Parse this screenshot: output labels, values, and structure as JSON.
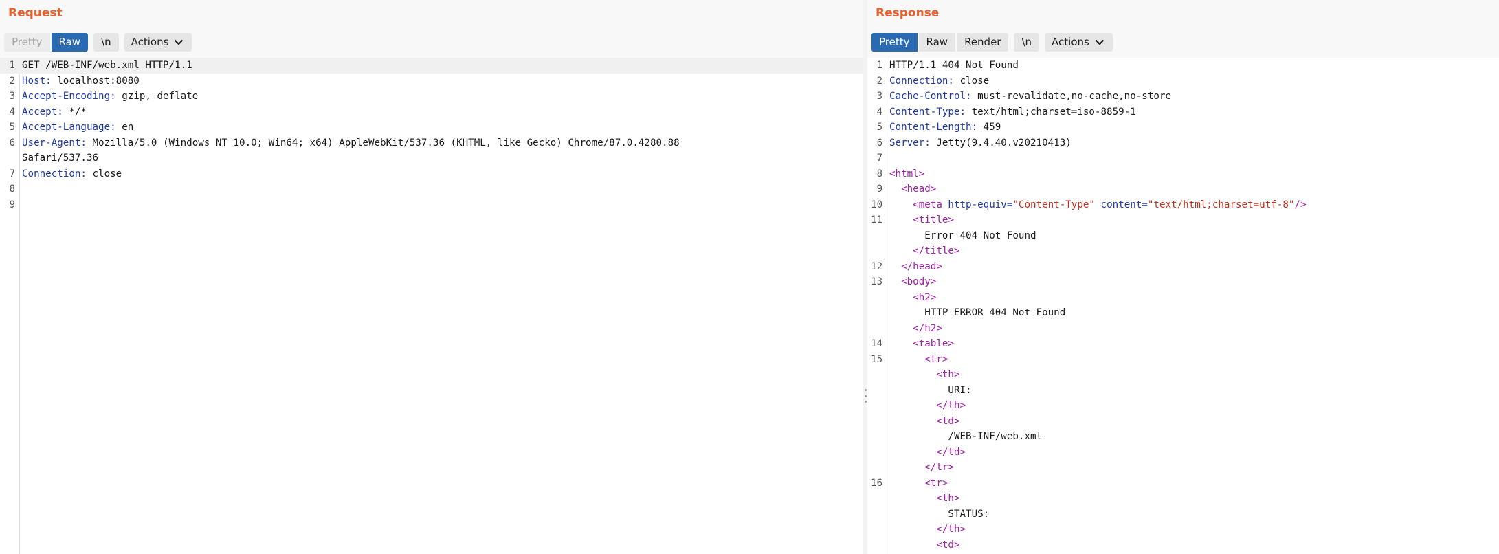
{
  "request": {
    "title": "Request",
    "buttons": {
      "pretty": "Pretty",
      "raw": "Raw",
      "newline": "\\n",
      "actions": "Actions"
    },
    "lines": [
      {
        "n": "1",
        "segs": [
          {
            "t": "txt",
            "v": "GET /WEB-INF/web.xml HTTP/1.1"
          }
        ]
      },
      {
        "n": "2",
        "segs": [
          {
            "t": "hdr-name",
            "v": "Host:"
          },
          {
            "t": "hdr-val",
            "v": " localhost:8080"
          }
        ]
      },
      {
        "n": "3",
        "segs": [
          {
            "t": "hdr-name",
            "v": "Accept-Encoding:"
          },
          {
            "t": "hdr-val",
            "v": " gzip, deflate"
          }
        ]
      },
      {
        "n": "4",
        "segs": [
          {
            "t": "hdr-name",
            "v": "Accept:"
          },
          {
            "t": "hdr-val",
            "v": " */*"
          }
        ]
      },
      {
        "n": "5",
        "segs": [
          {
            "t": "hdr-name",
            "v": "Accept-Language:"
          },
          {
            "t": "hdr-val",
            "v": " en"
          }
        ]
      },
      {
        "n": "6",
        "segs": [
          {
            "t": "hdr-name",
            "v": "User-Agent:"
          },
          {
            "t": "hdr-val",
            "v": " Mozilla/5.0 (Windows NT 10.0; Win64; x64) AppleWebKit/537.36 (KHTML, like Gecko) Chrome/87.0.4280.88"
          }
        ]
      },
      {
        "n": "",
        "segs": [
          {
            "t": "hdr-val",
            "v": "Safari/537.36"
          }
        ]
      },
      {
        "n": "7",
        "segs": [
          {
            "t": "hdr-name",
            "v": "Connection:"
          },
          {
            "t": "hdr-val",
            "v": " close"
          }
        ]
      },
      {
        "n": "8",
        "segs": []
      },
      {
        "n": "9",
        "segs": []
      }
    ]
  },
  "response": {
    "title": "Response",
    "buttons": {
      "pretty": "Pretty",
      "raw": "Raw",
      "render": "Render",
      "newline": "\\n",
      "actions": "Actions"
    },
    "lines": [
      {
        "n": "1",
        "segs": [
          {
            "t": "txt",
            "v": "HTTP/1.1 404 Not Found"
          }
        ]
      },
      {
        "n": "2",
        "segs": [
          {
            "t": "hdr-name",
            "v": "Connection:"
          },
          {
            "t": "hdr-val",
            "v": " close"
          }
        ]
      },
      {
        "n": "3",
        "segs": [
          {
            "t": "hdr-name",
            "v": "Cache-Control:"
          },
          {
            "t": "hdr-val",
            "v": " must-revalidate,no-cache,no-store"
          }
        ]
      },
      {
        "n": "4",
        "segs": [
          {
            "t": "hdr-name",
            "v": "Content-Type:"
          },
          {
            "t": "hdr-val",
            "v": " text/html;charset=iso-8859-1"
          }
        ]
      },
      {
        "n": "5",
        "segs": [
          {
            "t": "hdr-name",
            "v": "Content-Length:"
          },
          {
            "t": "hdr-val",
            "v": " 459"
          }
        ]
      },
      {
        "n": "6",
        "segs": [
          {
            "t": "hdr-name",
            "v": "Server:"
          },
          {
            "t": "hdr-val",
            "v": " Jetty(9.4.40.v20210413)"
          }
        ]
      },
      {
        "n": "7",
        "segs": []
      },
      {
        "n": "8",
        "segs": [
          {
            "t": "tag",
            "v": "<html>"
          }
        ]
      },
      {
        "n": "9",
        "segs": [
          {
            "t": "txt",
            "v": "  "
          },
          {
            "t": "tag",
            "v": "<head>"
          }
        ]
      },
      {
        "n": "10",
        "segs": [
          {
            "t": "txt",
            "v": "    "
          },
          {
            "t": "tag",
            "v": "<meta "
          },
          {
            "t": "attr",
            "v": "http-equiv="
          },
          {
            "t": "str",
            "v": "\"Content-Type\""
          },
          {
            "t": "txt",
            "v": " "
          },
          {
            "t": "attr",
            "v": "content="
          },
          {
            "t": "str",
            "v": "\"text/html;charset=utf-8\""
          },
          {
            "t": "tag",
            "v": "/>"
          }
        ]
      },
      {
        "n": "11",
        "segs": [
          {
            "t": "txt",
            "v": "    "
          },
          {
            "t": "tag",
            "v": "<title>"
          }
        ]
      },
      {
        "n": "",
        "segs": [
          {
            "t": "txt",
            "v": "      Error 404 Not Found"
          }
        ]
      },
      {
        "n": "",
        "segs": [
          {
            "t": "txt",
            "v": "    "
          },
          {
            "t": "tag",
            "v": "</title>"
          }
        ]
      },
      {
        "n": "12",
        "segs": [
          {
            "t": "txt",
            "v": "  "
          },
          {
            "t": "tag",
            "v": "</head>"
          }
        ]
      },
      {
        "n": "13",
        "segs": [
          {
            "t": "txt",
            "v": "  "
          },
          {
            "t": "tag",
            "v": "<body>"
          }
        ]
      },
      {
        "n": "",
        "segs": [
          {
            "t": "txt",
            "v": "    "
          },
          {
            "t": "tag",
            "v": "<h2>"
          }
        ]
      },
      {
        "n": "",
        "segs": [
          {
            "t": "txt",
            "v": "      HTTP ERROR 404 Not Found"
          }
        ]
      },
      {
        "n": "",
        "segs": [
          {
            "t": "txt",
            "v": "    "
          },
          {
            "t": "tag",
            "v": "</h2>"
          }
        ]
      },
      {
        "n": "14",
        "segs": [
          {
            "t": "txt",
            "v": "    "
          },
          {
            "t": "tag",
            "v": "<table>"
          }
        ]
      },
      {
        "n": "15",
        "segs": [
          {
            "t": "txt",
            "v": "      "
          },
          {
            "t": "tag",
            "v": "<tr>"
          }
        ]
      },
      {
        "n": "",
        "segs": [
          {
            "t": "txt",
            "v": "        "
          },
          {
            "t": "tag",
            "v": "<th>"
          }
        ]
      },
      {
        "n": "",
        "segs": [
          {
            "t": "txt",
            "v": "          URI:"
          }
        ]
      },
      {
        "n": "",
        "segs": [
          {
            "t": "txt",
            "v": "        "
          },
          {
            "t": "tag",
            "v": "</th>"
          }
        ]
      },
      {
        "n": "",
        "segs": [
          {
            "t": "txt",
            "v": "        "
          },
          {
            "t": "tag",
            "v": "<td>"
          }
        ]
      },
      {
        "n": "",
        "segs": [
          {
            "t": "txt",
            "v": "          /WEB-INF/web.xml"
          }
        ]
      },
      {
        "n": "",
        "segs": [
          {
            "t": "txt",
            "v": "        "
          },
          {
            "t": "tag",
            "v": "</td>"
          }
        ]
      },
      {
        "n": "",
        "segs": [
          {
            "t": "txt",
            "v": "      "
          },
          {
            "t": "tag",
            "v": "</tr>"
          }
        ]
      },
      {
        "n": "16",
        "segs": [
          {
            "t": "txt",
            "v": "      "
          },
          {
            "t": "tag",
            "v": "<tr>"
          }
        ]
      },
      {
        "n": "",
        "segs": [
          {
            "t": "txt",
            "v": "        "
          },
          {
            "t": "tag",
            "v": "<th>"
          }
        ]
      },
      {
        "n": "",
        "segs": [
          {
            "t": "txt",
            "v": "          STATUS:"
          }
        ]
      },
      {
        "n": "",
        "segs": [
          {
            "t": "txt",
            "v": "        "
          },
          {
            "t": "tag",
            "v": "</th>"
          }
        ]
      },
      {
        "n": "",
        "segs": [
          {
            "t": "txt",
            "v": "        "
          },
          {
            "t": "tag",
            "v": "<td>"
          }
        ]
      }
    ]
  },
  "colors": {
    "accent": "#e8602c",
    "active_button": "#2a6ab3",
    "header_name": "#1f3aa6",
    "tag": "#a11fa9",
    "string": "#c3311f"
  },
  "icons": {
    "chevron": "chevron-down-icon",
    "splitter": "drag-handle-icon"
  }
}
